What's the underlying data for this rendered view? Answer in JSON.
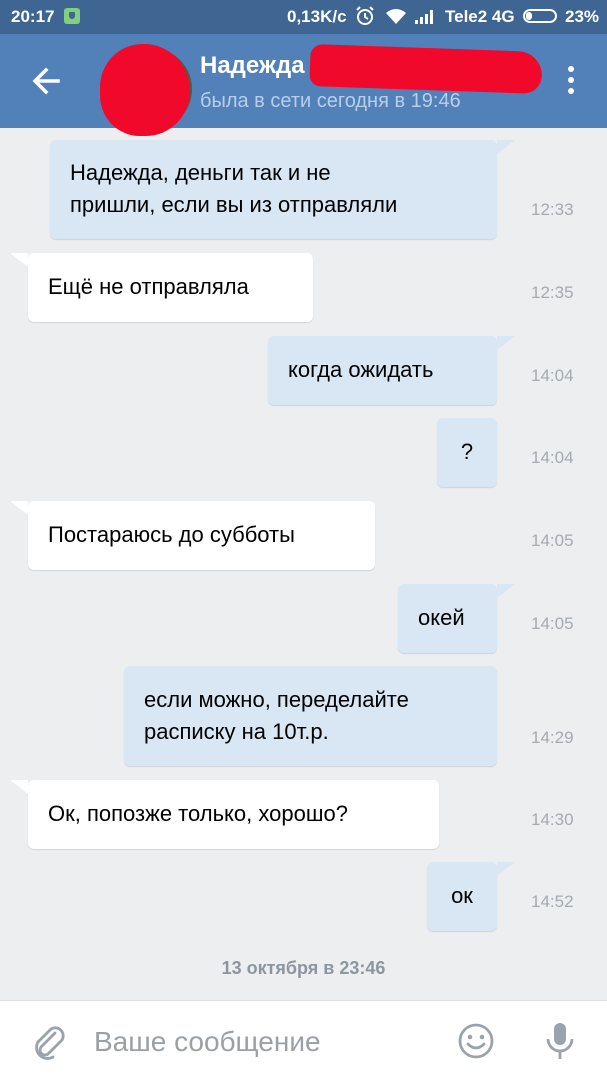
{
  "status_bar": {
    "time": "20:17",
    "network_speed": "0,13K/c",
    "carrier": "Tele2 4G",
    "battery_percent": "23%",
    "battery_level": 0.23,
    "icons": [
      "shield-icon",
      "alarm-icon",
      "wifi-icon",
      "signal-icon",
      "battery-icon"
    ]
  },
  "header": {
    "contact_name": "Надежда Н",
    "status": "была в сети сегодня в 19:46",
    "icons": [
      "back-arrow-icon",
      "more-vertical-icon"
    ]
  },
  "messages": [
    {
      "direction": "out",
      "text": "Надежда, деньги так и не\nпришли, если вы из отправляли",
      "time": "12:33"
    },
    {
      "direction": "in",
      "text": "Ещё не отправляла",
      "time": "12:35"
    },
    {
      "direction": "out",
      "text": "когда ожидать",
      "time": "14:04"
    },
    {
      "direction": "out",
      "text": "?",
      "time": "14:04"
    },
    {
      "direction": "in",
      "text": "Постараюсь до субботы",
      "time": "14:05"
    },
    {
      "direction": "out",
      "text": "окей",
      "time": "14:05"
    },
    {
      "direction": "out",
      "text": "если можно, переделайте\nрасписку на 10т.р.",
      "time": "14:29"
    },
    {
      "direction": "in",
      "text": "Ок, попозже только, хорошо?",
      "time": "14:30"
    },
    {
      "direction": "out",
      "text": "ок",
      "time": "14:52"
    }
  ],
  "date_separator": "13 октября в 23:46",
  "composer": {
    "placeholder": "Ваше сообщение",
    "icons": [
      "paperclip-icon",
      "emoji-icon",
      "microphone-icon"
    ]
  },
  "colors": {
    "header": "#5181b8",
    "status_bar": "#3f6593",
    "background": "#edeef0",
    "outgoing_bubble": "#d9e6f4",
    "incoming_bubble": "#ffffff"
  }
}
